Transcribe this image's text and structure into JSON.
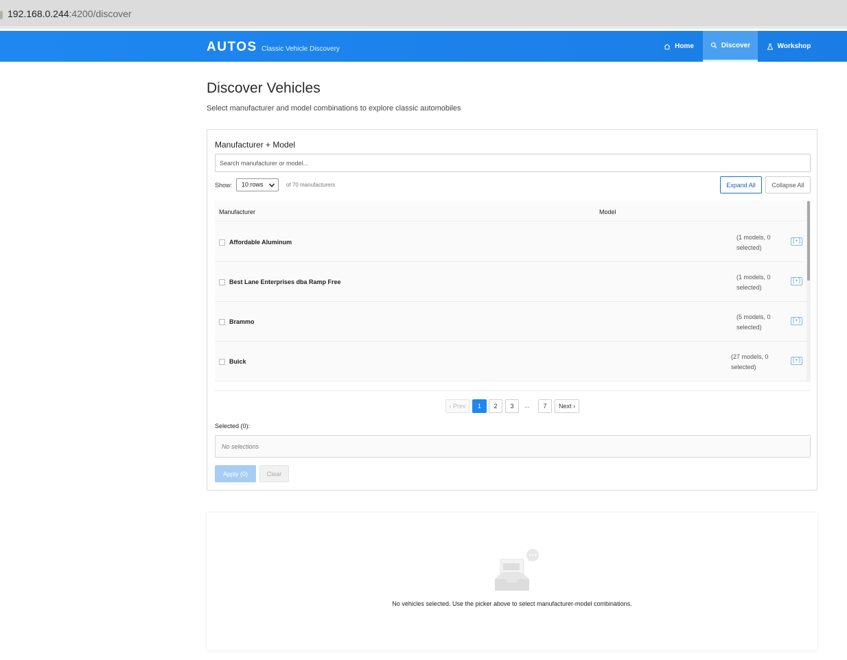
{
  "browser": {
    "url_host": "192.168.0.244",
    "url_rest": ":4200/discover"
  },
  "header": {
    "brand": "AUTOS",
    "subtitle": "Classic Vehicle Discovery",
    "nav": [
      {
        "label": "Home",
        "icon": "home-icon"
      },
      {
        "label": "Discover",
        "icon": "search-icon",
        "active": true
      },
      {
        "label": "Workshop",
        "icon": "flask-icon"
      }
    ]
  },
  "page": {
    "title": "Discover Vehicles",
    "subtitle": "Select manufacturer and model combinations to explore classic automobiles"
  },
  "picker": {
    "title": "Manufacturer + Model",
    "search_placeholder": "Search manufacturer or model...",
    "show_label": "Show:",
    "rows_value": "10 rows",
    "count_text": "of 70 manufacturers",
    "expand_all": "Expand All",
    "collapse_all": "Collapse All",
    "columns": [
      "Manufacturer",
      "Model"
    ],
    "rows": [
      {
        "name": "Affordable Aluminum",
        "count": "(1 models, 0 selected)",
        "expand": "[+]"
      },
      {
        "name": "Best Lane Enterprises dba Ramp Free",
        "count": "(1 models, 0 selected)",
        "expand": "[+]"
      },
      {
        "name": "Brammo",
        "count": "(5 models, 0 selected)",
        "expand": "[+]"
      },
      {
        "name": "Buick",
        "count": "(27 models, 0 selected)",
        "expand": "[+]"
      }
    ],
    "pagination": {
      "prev": "‹ Prev",
      "pages": [
        "1",
        "2",
        "3"
      ],
      "ellipsis": "...",
      "last": "7",
      "next": "Next ›",
      "current": 1
    },
    "selected_label": "Selected (0):",
    "no_selections": "No selections",
    "apply": "Apply (0)",
    "clear": "Clear"
  },
  "results": {
    "empty_message": "No vehicles selected. Use the picker above to select manufacturer-model combinations.",
    "empty_icon": "empty-inbox-icon"
  },
  "colors": {
    "primary": "#1e88f0",
    "nav_active": "#4aa0f0",
    "apply_disabled": "#a6cdf3"
  }
}
